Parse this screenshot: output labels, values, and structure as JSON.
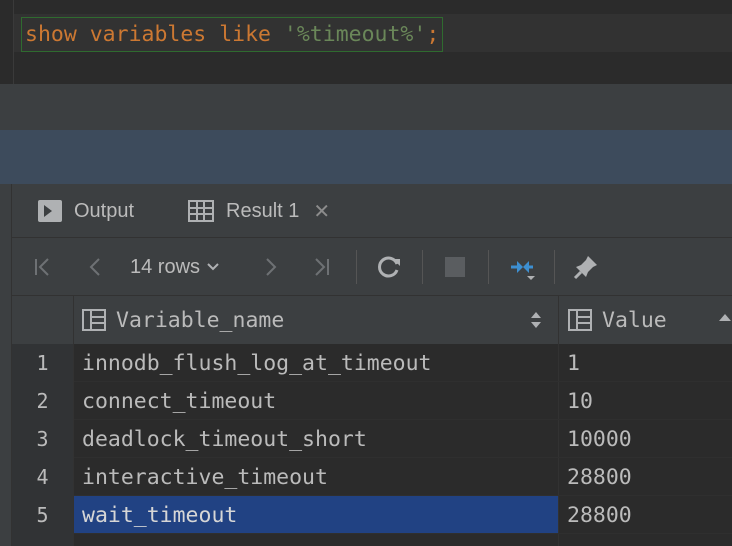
{
  "editor": {
    "query": {
      "keyword_show": "show",
      "keyword_variables": "variables",
      "keyword_like": "like",
      "string": "'%timeout%'",
      "terminator": ";"
    }
  },
  "tabs": [
    {
      "label": "Output",
      "icon": "console-icon"
    },
    {
      "label": "Result 1",
      "icon": "table-icon",
      "close": "✕"
    }
  ],
  "toolbar": {
    "rows_label": "14 rows",
    "icons": [
      "first-page-icon",
      "prev-page-icon",
      "next-page-icon",
      "last-page-icon",
      "refresh-icon",
      "stop-icon",
      "compare-icon",
      "pin-icon"
    ]
  },
  "grid": {
    "columns": [
      {
        "label": "Variable_name",
        "icon": "column-icon"
      },
      {
        "label": "Value",
        "icon": "column-icon"
      }
    ],
    "rows": [
      {
        "num": "1",
        "name": "innodb_flush_log_at_timeout",
        "value": "1"
      },
      {
        "num": "2",
        "name": "connect_timeout",
        "value": "10"
      },
      {
        "num": "3",
        "name": "deadlock_timeout_short",
        "value": "10000"
      },
      {
        "num": "4",
        "name": "interactive_timeout",
        "value": "28800"
      },
      {
        "num": "5",
        "name": "wait_timeout",
        "value": "28800"
      }
    ],
    "selected_cell": "row 5, Variable_name"
  },
  "colors": {
    "keyword": "#cc7832",
    "string": "#6a8759",
    "selection": "#214283",
    "background": "#2b2b2b"
  }
}
